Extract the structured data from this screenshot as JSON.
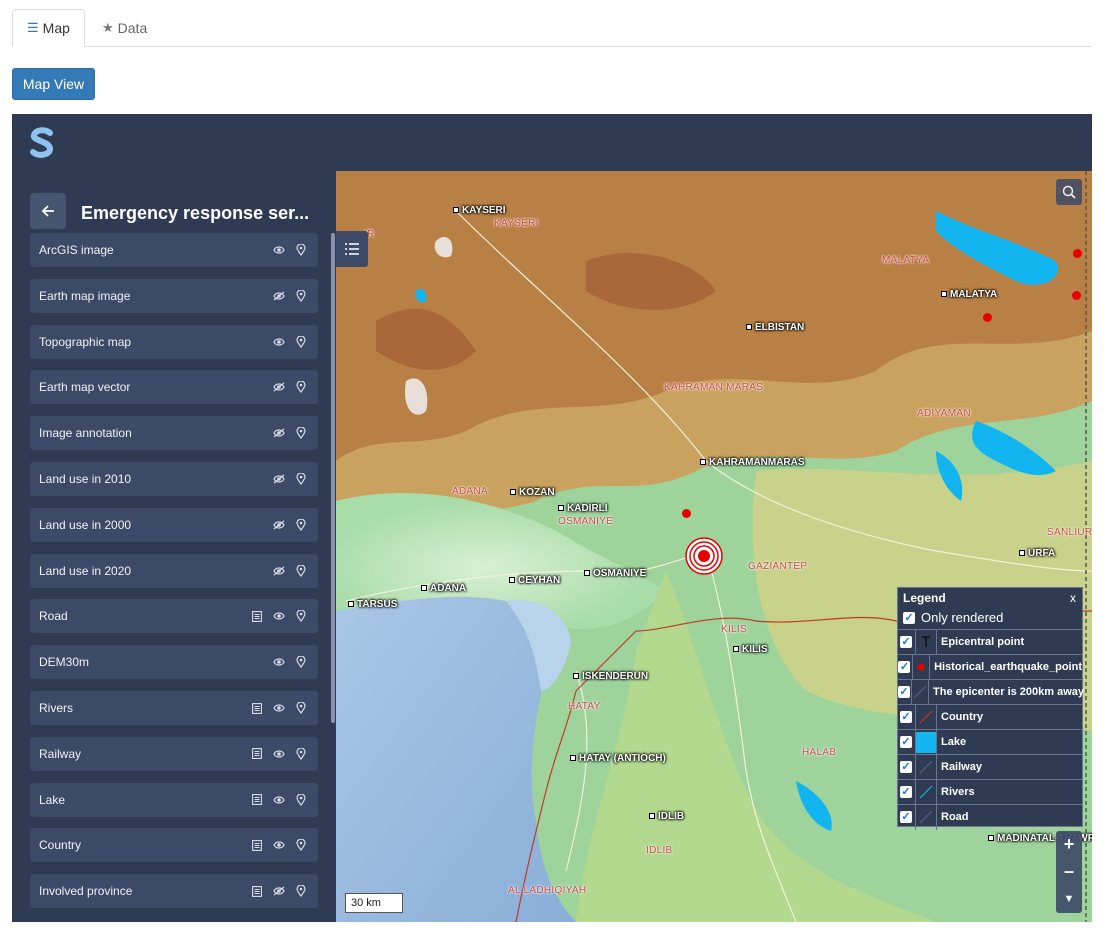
{
  "tabs": [
    {
      "label": "Map",
      "icon": "list-icon"
    },
    {
      "label": "Data",
      "icon": "star-icon"
    }
  ],
  "map_view_button": "Map View",
  "app": {
    "logo": "s-logo-icon"
  },
  "sidebar": {
    "title": "Emergency response ser...",
    "layers": [
      {
        "name": "ArcGIS image",
        "table": false,
        "visible": true
      },
      {
        "name": "Earth map image",
        "table": false,
        "visible": false
      },
      {
        "name": "Topographic map",
        "table": false,
        "visible": true
      },
      {
        "name": "Earth map vector",
        "table": false,
        "visible": false
      },
      {
        "name": "Image annotation",
        "table": false,
        "visible": false
      },
      {
        "name": "Land use in 2010",
        "table": false,
        "visible": false
      },
      {
        "name": "Land use in 2000",
        "table": false,
        "visible": false
      },
      {
        "name": "Land use in 2020",
        "table": false,
        "visible": false
      },
      {
        "name": "Road",
        "table": true,
        "visible": true
      },
      {
        "name": "DEM30m",
        "table": false,
        "visible": true
      },
      {
        "name": "Rivers",
        "table": true,
        "visible": true
      },
      {
        "name": "Railway",
        "table": true,
        "visible": true
      },
      {
        "name": "Lake",
        "table": true,
        "visible": true
      },
      {
        "name": "Country",
        "table": true,
        "visible": true
      },
      {
        "name": "Involved province",
        "table": true,
        "visible": false
      }
    ]
  },
  "map": {
    "scale": "30 km",
    "places": [
      {
        "name": "KAYSERI"
      },
      {
        "name": "MALATYA"
      },
      {
        "name": "ELBISTAN"
      },
      {
        "name": "KAHRAMANMARAS"
      },
      {
        "name": "KOZAN"
      },
      {
        "name": "KADIRLI"
      },
      {
        "name": "CEYHAN"
      },
      {
        "name": "OSMANIYE"
      },
      {
        "name": "ADANA"
      },
      {
        "name": "TARSUS"
      },
      {
        "name": "ISKENDERUN"
      },
      {
        "name": "KILIS"
      },
      {
        "name": "URFA"
      },
      {
        "name": "HATAY (ANTIOCH)"
      },
      {
        "name": "IDLIB"
      },
      {
        "name": "MADINATAL-THAWRA"
      },
      {
        "name": "AL LADHIQIYAH"
      }
    ],
    "regions": [
      {
        "name": "KAYSERI"
      },
      {
        "name": "MALATYA"
      },
      {
        "name": "KAHRAMAN MARAS"
      },
      {
        "name": "ADIYAMAN"
      },
      {
        "name": "ADANA"
      },
      {
        "name": "OSMANIYE"
      },
      {
        "name": "GAZIANTEP"
      },
      {
        "name": "SANLIUR"
      },
      {
        "name": "KILIS"
      },
      {
        "name": "HATAY"
      },
      {
        "name": "HALAB"
      },
      {
        "name": "IDLIB"
      },
      {
        "name": "AL LADHIQIYAH"
      },
      {
        "name": "IR"
      }
    ]
  },
  "legend": {
    "title": "Legend",
    "close": "x",
    "only_rendered": "Only rendered",
    "items": [
      {
        "label": "Epicentral point",
        "symbol": "epicenter-icon"
      },
      {
        "label": "Historical_earthquake_point",
        "symbol": "red-dot-icon",
        "color": "#e60000"
      },
      {
        "label": "The epicenter is 200km away",
        "symbol": "line-icon",
        "color": "#555f7a"
      },
      {
        "label": "Country",
        "symbol": "line-icon",
        "color": "#c0392b"
      },
      {
        "label": "Lake",
        "symbol": "fill-icon",
        "color": "#13b5f0"
      },
      {
        "label": "Railway",
        "symbol": "line-icon",
        "color": "#555f7a"
      },
      {
        "label": "Rivers",
        "symbol": "line-icon",
        "color": "#2aa8e0"
      },
      {
        "label": "Road",
        "symbol": "line-icon",
        "color": "#555f7a"
      }
    ]
  }
}
